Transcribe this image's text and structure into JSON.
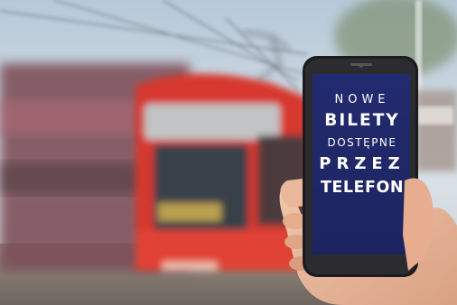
{
  "phone_screen": {
    "line1": "NOWE",
    "line2": "BILETY",
    "line3": "DOSTĘPNE",
    "line4": "PRZEZ",
    "line5": "TELEFON"
  },
  "colors": {
    "screen_blue": "#222a6e",
    "tram_red": "#d6382f",
    "sky": "#c9d8e4"
  }
}
